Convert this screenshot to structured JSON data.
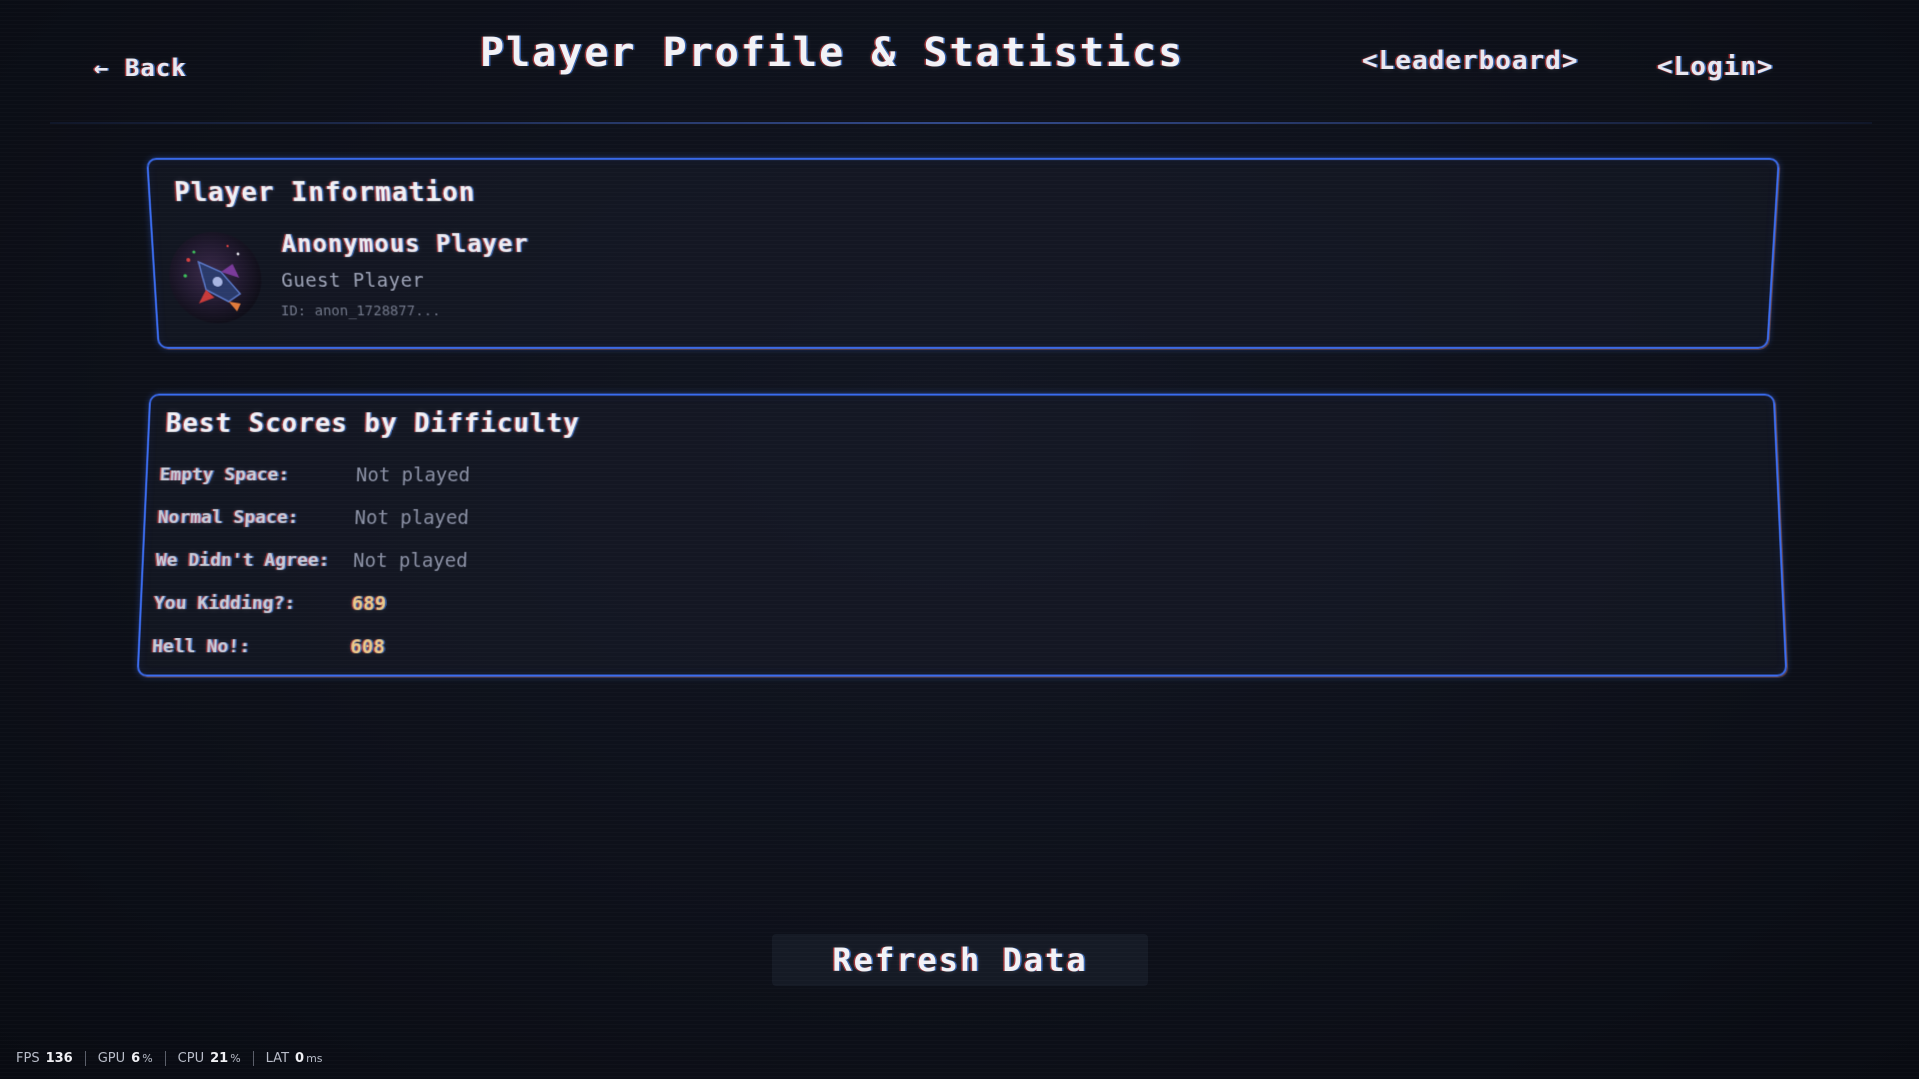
{
  "header": {
    "back_label": "← Back",
    "title": "Player Profile & Statistics",
    "nav": {
      "leaderboard": "<Leaderboard>",
      "login": "<Login>"
    }
  },
  "player_info": {
    "title": "Player Information",
    "name": "Anonymous Player",
    "role": "Guest Player",
    "id": "ID: anon_1728877..."
  },
  "best_scores": {
    "title": "Best Scores by Difficulty",
    "rows": [
      {
        "label": "Empty Space:",
        "value": "Not played"
      },
      {
        "label": "Normal Space:",
        "value": "Not played"
      },
      {
        "label": "We Didn't Agree:",
        "value": "Not played"
      },
      {
        "label": "You Kidding?:",
        "value": "689"
      },
      {
        "label": "Hell No!:",
        "value": "608"
      }
    ]
  },
  "refresh_label": "Refresh Data",
  "perf": {
    "fps_label": "FPS",
    "fps": "136",
    "gpu_label": "GPU",
    "gpu": "6",
    "gpu_unit": "%",
    "cpu_label": "CPU",
    "cpu": "21",
    "cpu_unit": "%",
    "lat_label": "LAT",
    "lat": "0",
    "lat_unit": "ms"
  },
  "colors": {
    "accent": "#3a6cf0",
    "background": "#0d1019",
    "score_highlight": "#e9c98a"
  }
}
